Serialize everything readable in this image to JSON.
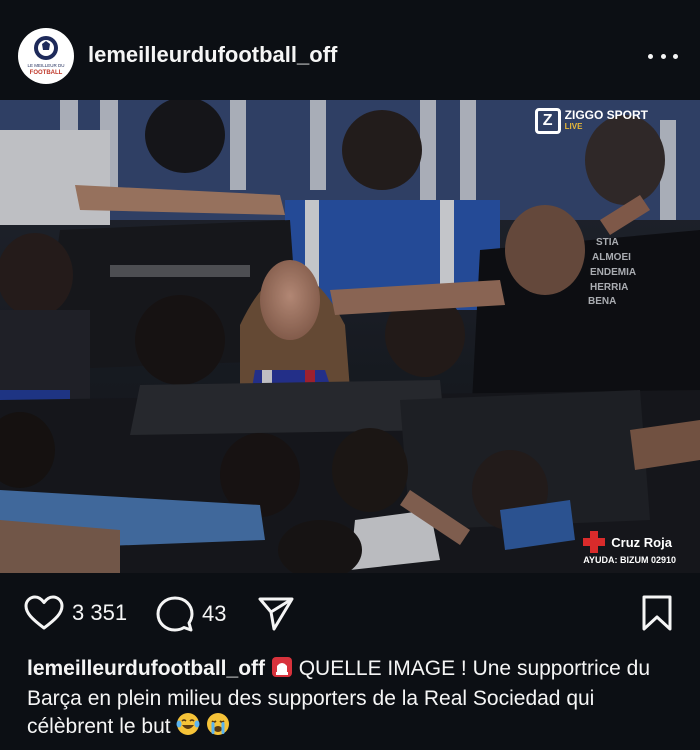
{
  "post": {
    "username": "lemeilleurdufootball_off",
    "avatar": {
      "icon": "football-club-logo-icon",
      "caption_line1": "LE MEILLEUR DU",
      "caption_line2": "FOOTBALL",
      "brand_color": "#c0392b"
    },
    "menu_icon": "more-options-icon"
  },
  "media": {
    "broadcaster": {
      "logo": "Z",
      "name": "ZIGGO SPORT",
      "tag": "LIVE",
      "tag_color": "#e8b938"
    },
    "sponsor": {
      "org": "Cruz Roja",
      "help": "AYUDA: BIZUM 02910",
      "color": "#d92b2b"
    }
  },
  "actions": {
    "likes": "3 351",
    "comments": "43",
    "icons": [
      "heart-icon",
      "comment-icon",
      "share-icon",
      "bookmark-icon"
    ]
  },
  "caption": {
    "username": "lemeilleurdufootball_off",
    "text": "QUELLE IMAGE ! Une supportrice du Barça en plein milieu des supporters de la Real Sociedad qui célèbrent le but",
    "emojis": [
      "siren-emoji",
      "laughing-tears-emoji",
      "crying-emoji"
    ]
  }
}
